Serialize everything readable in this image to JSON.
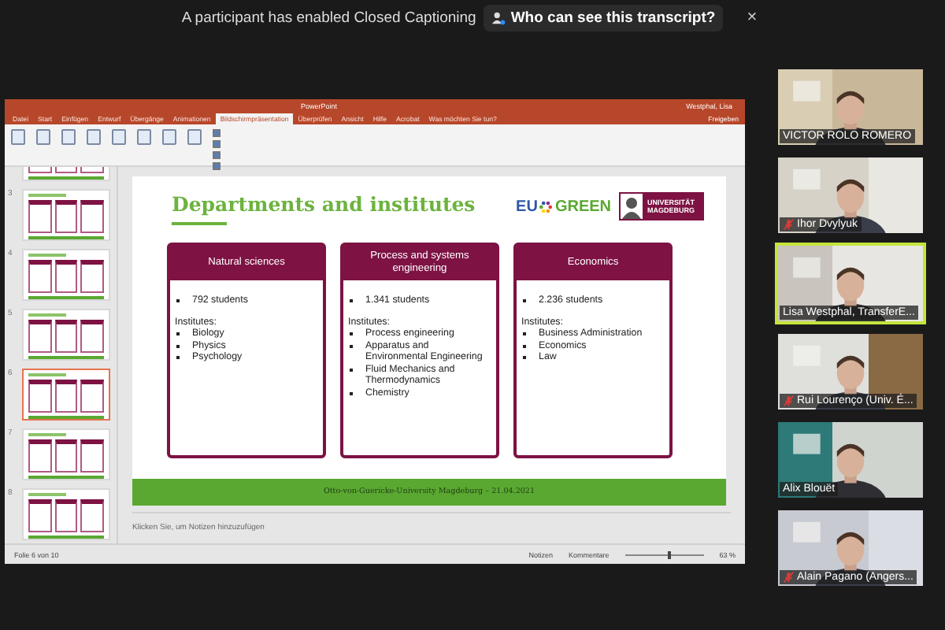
{
  "banner": {
    "message": "A participant has enabled Closed Captioning",
    "button": "Who can see this transcript?",
    "close": "×"
  },
  "powerpoint": {
    "title": "PowerPoint",
    "user": "Westphal, Lisa",
    "tabs": [
      {
        "label": "Datei",
        "selected": false
      },
      {
        "label": "Start",
        "selected": false
      },
      {
        "label": "Einfügen",
        "selected": false
      },
      {
        "label": "Entwurf",
        "selected": false
      },
      {
        "label": "Übergänge",
        "selected": false
      },
      {
        "label": "Animationen",
        "selected": false
      },
      {
        "label": "Bildschirmpräsentation",
        "selected": true
      },
      {
        "label": "Überprüfen",
        "selected": false
      },
      {
        "label": "Ansicht",
        "selected": false
      },
      {
        "label": "Hilfe",
        "selected": false
      },
      {
        "label": "Acrobat",
        "selected": false
      },
      {
        "label": "Was möchten Sie tun?",
        "selected": false
      }
    ],
    "share": "Freigeben",
    "ribbon_checkboxes": [
      {
        "checked": true
      },
      {
        "checked": true
      },
      {
        "checked": true
      },
      {
        "checked": true
      }
    ],
    "thumbnails": [
      {
        "selected": false
      },
      {
        "number": "3",
        "selected": false
      },
      {
        "number": "4",
        "selected": false
      },
      {
        "number": "5",
        "selected": false
      },
      {
        "number": "6",
        "selected": true
      },
      {
        "number": "7",
        "selected": false
      },
      {
        "number": "8",
        "selected": false
      }
    ],
    "slide": {
      "title": "Departments and institutes",
      "logo_eu": "EU",
      "logo_green": "GREEN",
      "logo_uni": "UNIVERSITÄT MAGDEBURG",
      "cards": [
        {
          "title": "Natural sciences",
          "students": "792 students",
          "institutes_label": "Institutes:",
          "institutes": [
            "Biology",
            "Physics",
            "Psychology"
          ]
        },
        {
          "title": "Process and systems engineering",
          "students": "1.341 students",
          "institutes_label": "Institutes:",
          "institutes": [
            "Process engineering",
            "Apparatus and Environmental Engineering",
            "Fluid Mechanics and Thermodynamics",
            "Chemistry"
          ]
        },
        {
          "title": "Economics",
          "students": "2.236 students",
          "institutes_label": "Institutes:",
          "institutes": [
            "Business Administration",
            "Economics",
            "Law"
          ]
        }
      ],
      "footer": "Otto-von-Guericke-University Magdeburg – 21.04.2021"
    },
    "notes_placeholder": "Klicken Sie, um Notizen hinzuzufügen",
    "status": {
      "slide": "Folie 6 von 10",
      "notes": "Notizen",
      "comments": "Kommentare",
      "zoom": "63 %",
      "level": 0.55
    }
  },
  "participants": [
    {
      "name": "VICTOR ROLO ROMERO",
      "muted": false,
      "speaking": false
    },
    {
      "name": "Ihor Dvylyuk",
      "muted": true,
      "speaking": false
    },
    {
      "name": "Lisa Westphal, TransferE...",
      "muted": false,
      "speaking": true
    },
    {
      "name": "Rui Lourenço (Univ. É...",
      "muted": true,
      "speaking": false
    },
    {
      "name": "Alix Blouët",
      "muted": false,
      "speaking": false
    },
    {
      "name": "Alain Pagano (Angers...",
      "muted": true,
      "speaking": false
    }
  ]
}
